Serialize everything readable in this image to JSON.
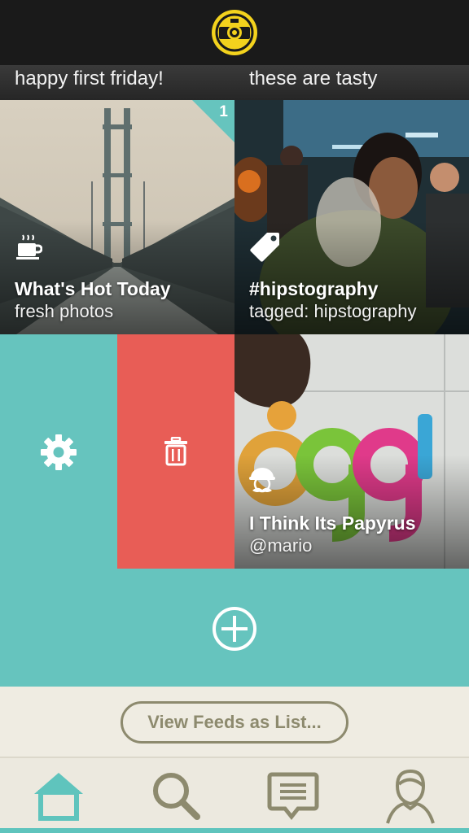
{
  "header": {
    "logo_icon": "camera-lens-icon"
  },
  "strips": [
    {
      "text": "happy first friday!"
    },
    {
      "text": "these are tasty"
    }
  ],
  "tiles": [
    {
      "title": "What's Hot Today",
      "subtitle": "fresh photos",
      "icon": "coffee-cup-icon",
      "badge": "1"
    },
    {
      "title": "#hipstography",
      "subtitle": "tagged: hipstography",
      "icon": "tag-icon"
    },
    {
      "title": "I Think Its Papyrus",
      "subtitle": "@mario",
      "icon": "mustache-avatar-icon"
    }
  ],
  "edit_actions": {
    "settings_icon": "gear-icon",
    "delete_icon": "trash-icon"
  },
  "add_feed": {
    "icon": "plus-circle-icon"
  },
  "view_list_button": {
    "label": "View Feeds as List..."
  },
  "tabbar": {
    "items": [
      {
        "name": "home",
        "icon": "home-icon",
        "active": true
      },
      {
        "name": "search",
        "icon": "search-icon",
        "active": false
      },
      {
        "name": "messages",
        "icon": "chat-icon",
        "active": false
      },
      {
        "name": "profile",
        "icon": "profile-icon",
        "active": false
      }
    ]
  },
  "colors": {
    "accent_teal": "#66c4be",
    "delete_red": "#e85d56",
    "logo_yellow": "#f3d21d",
    "cream": "#efece2",
    "olive": "#8d8a6e"
  }
}
